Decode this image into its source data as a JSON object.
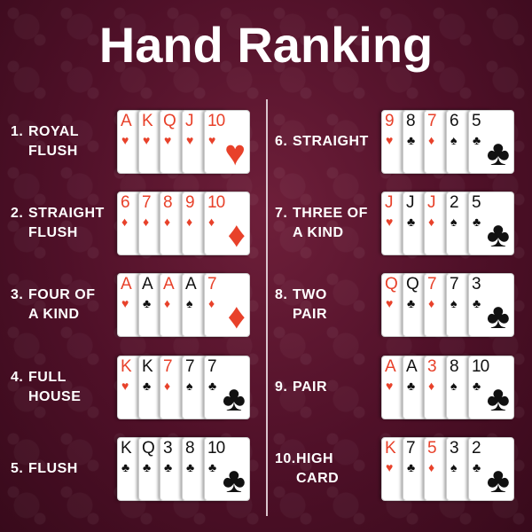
{
  "title": "Hand Ranking",
  "colors": {
    "red": "#e8412a",
    "black": "#111111",
    "background": "#541229"
  },
  "hands": [
    {
      "num": "1.",
      "label": [
        "ROYAL",
        "FLUSH"
      ],
      "cards": [
        {
          "rank": "A",
          "suit": "♥",
          "color": "red"
        },
        {
          "rank": "K",
          "suit": "♥",
          "color": "red"
        },
        {
          "rank": "Q",
          "suit": "♥",
          "color": "red"
        },
        {
          "rank": "J",
          "suit": "♥",
          "color": "red"
        },
        {
          "rank": "10",
          "suit": "♥",
          "color": "red"
        }
      ]
    },
    {
      "num": "2.",
      "label": [
        "STRAIGHT",
        "FLUSH"
      ],
      "cards": [
        {
          "rank": "6",
          "suit": "♦",
          "color": "red"
        },
        {
          "rank": "7",
          "suit": "♦",
          "color": "red"
        },
        {
          "rank": "8",
          "suit": "♦",
          "color": "red"
        },
        {
          "rank": "9",
          "suit": "♦",
          "color": "red"
        },
        {
          "rank": "10",
          "suit": "♦",
          "color": "red"
        }
      ]
    },
    {
      "num": "3.",
      "label": [
        "FOUR OF",
        "A KIND"
      ],
      "cards": [
        {
          "rank": "A",
          "suit": "♥",
          "color": "red"
        },
        {
          "rank": "A",
          "suit": "♣",
          "color": "black"
        },
        {
          "rank": "A",
          "suit": "♦",
          "color": "red"
        },
        {
          "rank": "A",
          "suit": "♠",
          "color": "black"
        },
        {
          "rank": "7",
          "suit": "♦",
          "color": "red"
        }
      ]
    },
    {
      "num": "4.",
      "label": [
        "FULL",
        "HOUSE"
      ],
      "cards": [
        {
          "rank": "K",
          "suit": "♥",
          "color": "red"
        },
        {
          "rank": "K",
          "suit": "♣",
          "color": "black"
        },
        {
          "rank": "7",
          "suit": "♦",
          "color": "red"
        },
        {
          "rank": "7",
          "suit": "♠",
          "color": "black"
        },
        {
          "rank": "7",
          "suit": "♣",
          "color": "black"
        }
      ]
    },
    {
      "num": "5.",
      "label": [
        "FLUSH"
      ],
      "cards": [
        {
          "rank": "K",
          "suit": "♣",
          "color": "black"
        },
        {
          "rank": "Q",
          "suit": "♣",
          "color": "black"
        },
        {
          "rank": "3",
          "suit": "♣",
          "color": "black"
        },
        {
          "rank": "8",
          "suit": "♣",
          "color": "black"
        },
        {
          "rank": "10",
          "suit": "♣",
          "color": "black"
        }
      ]
    },
    {
      "num": "6.",
      "label": [
        "STRAIGHT"
      ],
      "cards": [
        {
          "rank": "9",
          "suit": "♥",
          "color": "red"
        },
        {
          "rank": "8",
          "suit": "♣",
          "color": "black"
        },
        {
          "rank": "7",
          "suit": "♦",
          "color": "red"
        },
        {
          "rank": "6",
          "suit": "♠",
          "color": "black"
        },
        {
          "rank": "5",
          "suit": "♣",
          "color": "black"
        }
      ]
    },
    {
      "num": "7.",
      "label": [
        "THREE OF",
        "A KIND"
      ],
      "cards": [
        {
          "rank": "J",
          "suit": "♥",
          "color": "red"
        },
        {
          "rank": "J",
          "suit": "♣",
          "color": "black"
        },
        {
          "rank": "J",
          "suit": "♦",
          "color": "red"
        },
        {
          "rank": "2",
          "suit": "♠",
          "color": "black"
        },
        {
          "rank": "5",
          "suit": "♣",
          "color": "black"
        }
      ]
    },
    {
      "num": "8.",
      "label": [
        "TWO",
        "PAIR"
      ],
      "cards": [
        {
          "rank": "Q",
          "suit": "♥",
          "color": "red"
        },
        {
          "rank": "Q",
          "suit": "♣",
          "color": "black"
        },
        {
          "rank": "7",
          "suit": "♦",
          "color": "red"
        },
        {
          "rank": "7",
          "suit": "♠",
          "color": "black"
        },
        {
          "rank": "3",
          "suit": "♣",
          "color": "black"
        }
      ]
    },
    {
      "num": "9.",
      "label": [
        "PAIR"
      ],
      "cards": [
        {
          "rank": "A",
          "suit": "♥",
          "color": "red"
        },
        {
          "rank": "A",
          "suit": "♣",
          "color": "black"
        },
        {
          "rank": "3",
          "suit": "♦",
          "color": "red"
        },
        {
          "rank": "8",
          "suit": "♠",
          "color": "black"
        },
        {
          "rank": "10",
          "suit": "♣",
          "color": "black"
        }
      ]
    },
    {
      "num": "10.",
      "label": [
        "HIGH",
        "CARD"
      ],
      "cards": [
        {
          "rank": "K",
          "suit": "♥",
          "color": "red"
        },
        {
          "rank": "7",
          "suit": "♣",
          "color": "black"
        },
        {
          "rank": "5",
          "suit": "♦",
          "color": "red"
        },
        {
          "rank": "3",
          "suit": "♠",
          "color": "black"
        },
        {
          "rank": "2",
          "suit": "♣",
          "color": "black"
        }
      ]
    }
  ]
}
